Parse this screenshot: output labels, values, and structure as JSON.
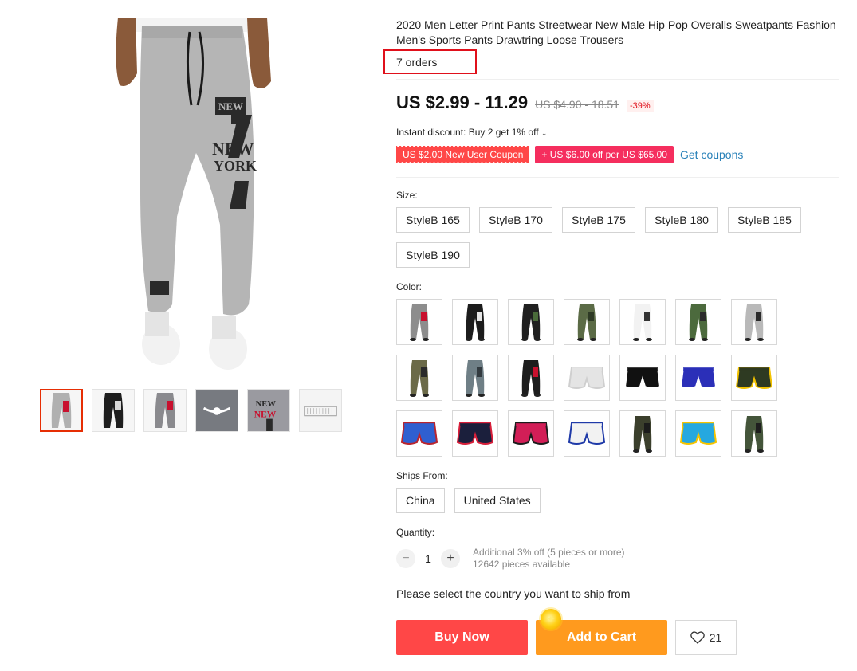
{
  "product": {
    "title": "2020 Men Letter Print Pants Streetwear New Male Hip Pop Overalls Sweatpants Fashion Men's Sports Pants Drawtring Loose Trousers",
    "orders": "7 orders",
    "price": "US $2.99 - 11.29",
    "price_original": "US $4.90 - 18.51",
    "discount": "-39%",
    "instant_discount": "Instant discount: Buy 2 get 1% off",
    "coupons": [
      {
        "label": "US $2.00 New User Coupon",
        "color": "#ff4747"
      },
      {
        "label": "+ US $6.00 off per US $65.00",
        "color": "#f52e5e"
      }
    ],
    "get_coupons": "Get coupons"
  },
  "gallery": {
    "main_image_icon": "sweatpants-grey-new-york-photo",
    "thumbnails": [
      {
        "name": "grey pants",
        "color": "#b0b0b0"
      },
      {
        "name": "black pants",
        "color": "#2a2a2a"
      },
      {
        "name": "grey pants side",
        "color": "#8a8a8e"
      },
      {
        "name": "waistband drawstring",
        "color": "#777a80"
      },
      {
        "name": "new york print detail",
        "color": "#9a9aa0"
      },
      {
        "name": "size chart",
        "color": "#eeeeee"
      }
    ]
  },
  "size": {
    "label": "Size:",
    "options": [
      "StyleB 165",
      "StyleB 170",
      "StyleB 175",
      "StyleB 180",
      "StyleB 185",
      "StyleB 190"
    ]
  },
  "color": {
    "label": "Color:",
    "swatches": [
      {
        "kind": "pants",
        "main": "#8d8d8d",
        "accent": "#c8102e"
      },
      {
        "kind": "pants",
        "main": "#1c1c1c",
        "accent": "#e6e6e6"
      },
      {
        "kind": "pants",
        "main": "#202020",
        "accent": "#4a6b3a"
      },
      {
        "kind": "pants",
        "main": "#5b6b46",
        "accent": "#2e3a25"
      },
      {
        "kind": "pants",
        "main": "#f2f2f2",
        "accent": "#333333"
      },
      {
        "kind": "pants",
        "main": "#4c6a3d",
        "accent": "#2b2b2b"
      },
      {
        "kind": "pants",
        "main": "#b9b9b9",
        "accent": "#2b2b2b"
      },
      {
        "kind": "pants",
        "main": "#6b6a48",
        "accent": "#2a2a2a"
      },
      {
        "kind": "pants",
        "main": "#6f7f86",
        "accent": "#333b40"
      },
      {
        "kind": "pants",
        "main": "#1d1d1d",
        "accent": "#c8102e"
      },
      {
        "kind": "shorts",
        "main": "#e4e4e4",
        "accent": "#cfcfcf"
      },
      {
        "kind": "shorts",
        "main": "#111111",
        "accent": "#ffffff"
      },
      {
        "kind": "shorts",
        "main": "#2b2fb8",
        "accent": "#ffffff"
      },
      {
        "kind": "shorts",
        "main": "#2e3a22",
        "accent": "#f2c200"
      },
      {
        "kind": "shorts",
        "main": "#2f5fd0",
        "accent": "#b8252f"
      },
      {
        "kind": "shorts",
        "main": "#1b1f3c",
        "accent": "#d71f3a"
      },
      {
        "kind": "shorts",
        "main": "#d21e57",
        "accent": "#1c1c1c"
      },
      {
        "kind": "shorts",
        "main": "#f2f2f2",
        "accent": "#1f3aa8"
      },
      {
        "kind": "pants",
        "main": "#3b3f2c",
        "accent": "#1b1b1b"
      },
      {
        "kind": "shorts",
        "main": "#25a8e0",
        "accent": "#f6c400"
      },
      {
        "kind": "pants",
        "main": "#44553a",
        "accent": "#1e1e1e"
      }
    ]
  },
  "ships_from": {
    "label": "Ships From:",
    "options": [
      "China",
      "United States"
    ]
  },
  "quantity": {
    "label": "Quantity:",
    "minus": "−",
    "value": "1",
    "plus": "+",
    "note_line1": "Additional 3% off (5 pieces or more)",
    "note_line2": "12642 pieces available"
  },
  "ship_message": "Please select the country you want to ship from",
  "actions": {
    "buy_now": "Buy Now",
    "add_to_cart": "Add to Cart",
    "wishlist_count": "21"
  }
}
